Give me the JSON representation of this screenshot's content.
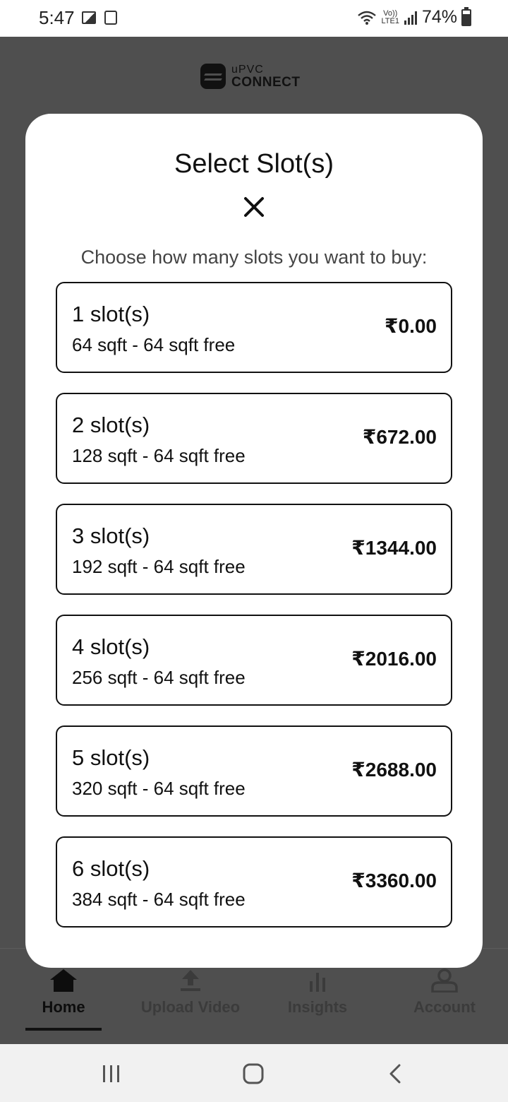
{
  "status_bar": {
    "time": "5:47",
    "network_label_top": "Vo))",
    "network_label_bottom": "LTE1",
    "battery_percent": "74%"
  },
  "app": {
    "logo_line1": "uPVC",
    "logo_line2": "CONNECT"
  },
  "modal": {
    "title": "Select Slot(s)",
    "subtitle": "Choose how many slots you want to buy:",
    "slots": [
      {
        "count": "1 slot(s)",
        "area": "64 sqft - 64 sqft free",
        "price": "₹0.00"
      },
      {
        "count": "2 slot(s)",
        "area": "128 sqft - 64 sqft free",
        "price": "₹672.00"
      },
      {
        "count": "3 slot(s)",
        "area": "192 sqft - 64 sqft free",
        "price": "₹1344.00"
      },
      {
        "count": "4 slot(s)",
        "area": "256 sqft - 64 sqft free",
        "price": "₹2016.00"
      },
      {
        "count": "5 slot(s)",
        "area": "320 sqft - 64 sqft free",
        "price": "₹2688.00"
      },
      {
        "count": "6 slot(s)",
        "area": "384 sqft - 64 sqft free",
        "price": "₹3360.00"
      }
    ]
  },
  "bottom_nav": {
    "items": [
      {
        "label": "Home",
        "icon": "home-icon",
        "active": true
      },
      {
        "label": "Upload Video",
        "icon": "upload-icon",
        "active": false
      },
      {
        "label": "Insights",
        "icon": "bar-chart-icon",
        "active": false
      },
      {
        "label": "Account",
        "icon": "account-icon",
        "active": false
      }
    ]
  },
  "colors": {
    "overlay_background": "#4f4f4f",
    "modal_background": "#ffffff",
    "text_primary": "#111111"
  }
}
